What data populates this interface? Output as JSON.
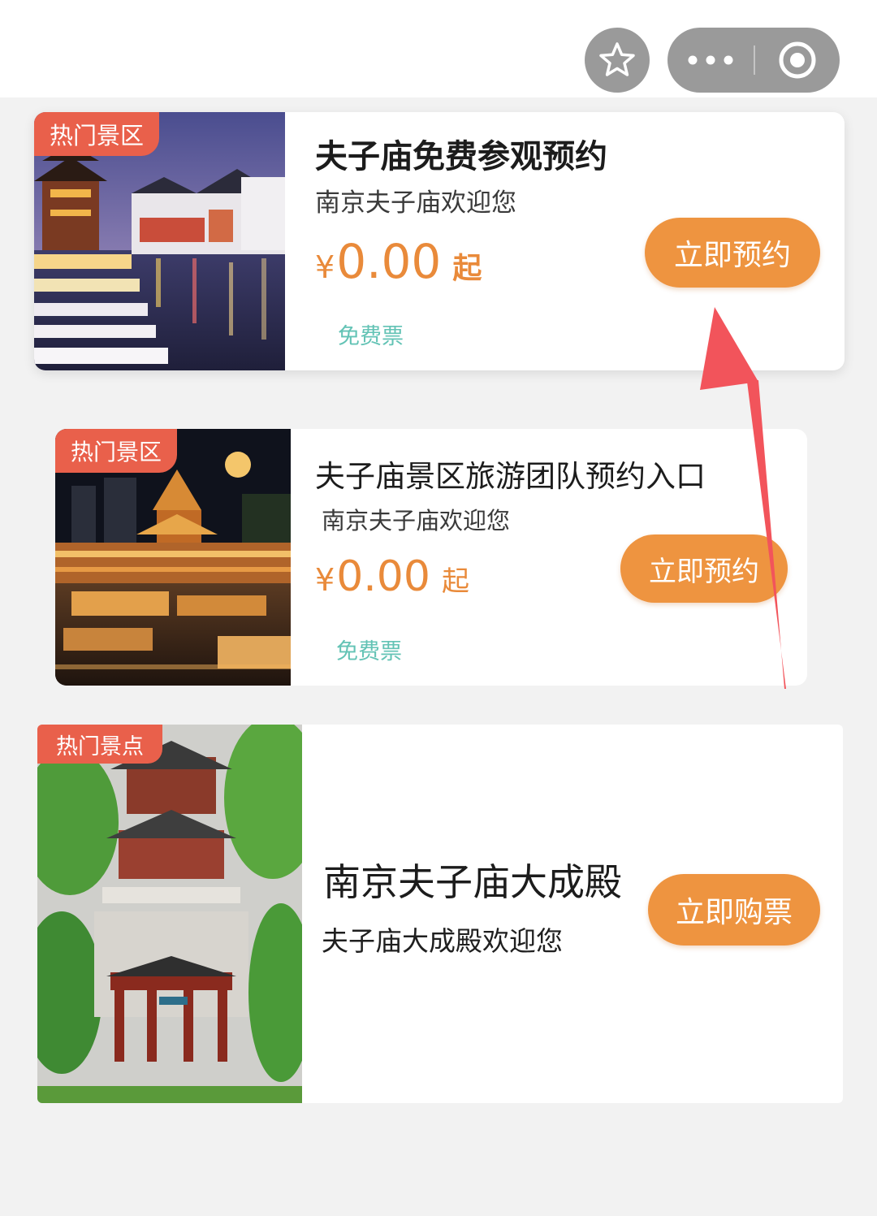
{
  "header": {
    "favorite_icon": "star-outline-icon",
    "more_icon": "more-dots-icon",
    "close_icon": "target-circle-icon"
  },
  "colors": {
    "badge": "#e9604b",
    "price": "#e98a3a",
    "button": "#ee9440",
    "free_tag": "#63c3b5",
    "arrow": "#f2545b"
  },
  "cards": [
    {
      "badge": "热门景区",
      "title": "夫子庙免费参观预约",
      "subtitle": "南京夫子庙欢迎您",
      "price_currency": "¥",
      "price_value": "0.00",
      "price_suffix": "起",
      "tag": "免费票",
      "button": "立即预约"
    },
    {
      "badge": "热门景区",
      "title": "夫子庙景区旅游团队预约入口",
      "subtitle": "南京夫子庙欢迎您",
      "price_currency": "¥",
      "price_value": "0.00",
      "price_suffix": "起",
      "tag": "免费票",
      "button": "立即预约"
    },
    {
      "badge": "热门景点",
      "title": "南京夫子庙大成殿",
      "subtitle": "夫子庙大成殿欢迎您",
      "button": "立即购票"
    }
  ]
}
